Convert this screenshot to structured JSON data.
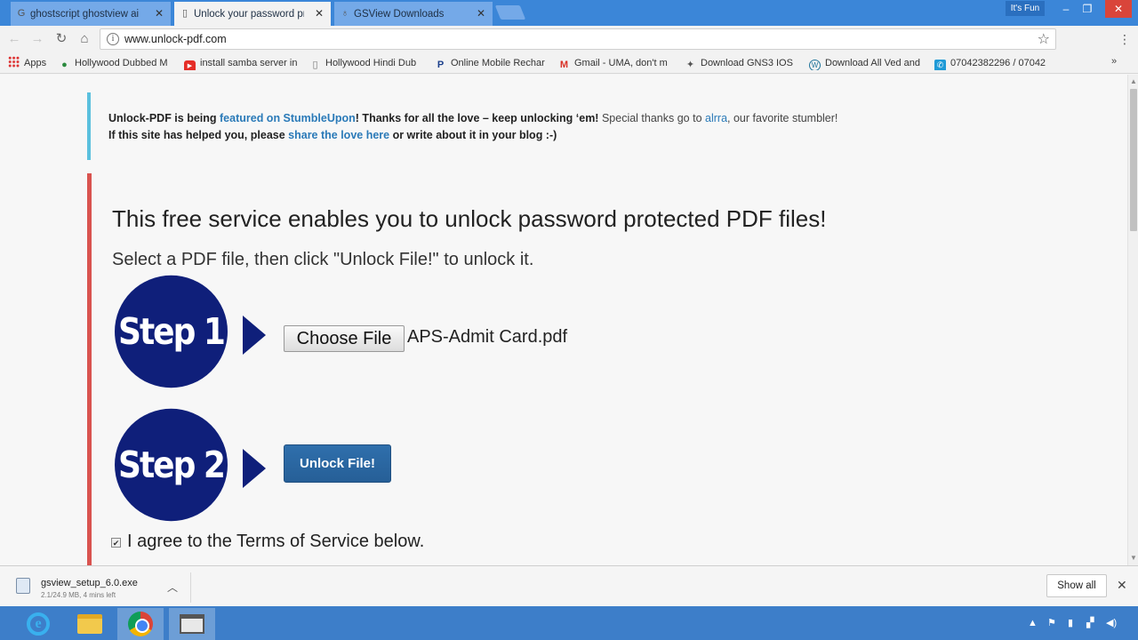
{
  "tabs": [
    {
      "title": "ghostscript ghostview ai",
      "favicon": "google-g-icon",
      "active": false
    },
    {
      "title": "Unlock your password pr",
      "favicon": "page-icon",
      "active": true
    },
    {
      "title": "GSView Downloads",
      "favicon": "gsview-icon",
      "active": false
    }
  ],
  "window": {
    "profile_label": "It's Fun"
  },
  "toolbar": {
    "url": "www.unlock-pdf.com"
  },
  "bookmarks": {
    "items": [
      {
        "label": "Apps",
        "icon": "apps-grid-icon"
      },
      {
        "label": "Hollywood Dubbed M",
        "icon": "green-leaf-icon"
      },
      {
        "label": "install samba server in",
        "icon": "youtube-icon"
      },
      {
        "label": "Hollywood Hindi Dub",
        "icon": "page-icon"
      },
      {
        "label": "Online Mobile Rechar",
        "icon": "paytm-icon"
      },
      {
        "label": "Gmail - UMA, don't m",
        "icon": "gmail-icon"
      },
      {
        "label": "Download GNS3 IOS",
        "icon": "gns3-icon"
      },
      {
        "label": "Download All Ved and",
        "icon": "wordpress-icon"
      },
      {
        "label": "07042382296 / 07042",
        "icon": "phone-icon"
      }
    ]
  },
  "notice": {
    "p1_a": "Unlock-PDF is being ",
    "p1_link": "featured on StumbleUpon",
    "p1_b": "! Thanks for all the love – keep unlocking ‘em!",
    "p1_c": " Special thanks go to ",
    "p1_link2": "alrra",
    "p1_d": ", our favorite stumbler!",
    "p2_a": "If this site has helped you, please ",
    "p2_link": "share the love here",
    "p2_b": " or write about it in your blog :-)"
  },
  "main": {
    "headline": "This free service enables you to unlock password protected PDF files!",
    "subline": "Select a PDF file, then click \"Unlock File!\" to unlock it.",
    "step1_label": "Step 1",
    "step2_label": "Step 2",
    "choose_file_label": "Choose File",
    "file_name": "APS-Admit Card.pdf",
    "unlock_label": "Unlock File!",
    "agree_label": "I agree to the Terms of Service below.",
    "agree_checked": true
  },
  "download_shelf": {
    "file_name": "gsview_setup_6.0.exe",
    "status": "2.1/24.9 MB, 4 mins left",
    "show_all_label": "Show all"
  },
  "colors": {
    "tab_bar": "#3b86d8",
    "notice_border": "#5bc0de",
    "panel_border": "#d9534f",
    "step_navy": "#0f1f7a",
    "unlock_button": "#2f6fac",
    "link": "#2a7ab8",
    "taskbar": "#3d7ec9"
  }
}
